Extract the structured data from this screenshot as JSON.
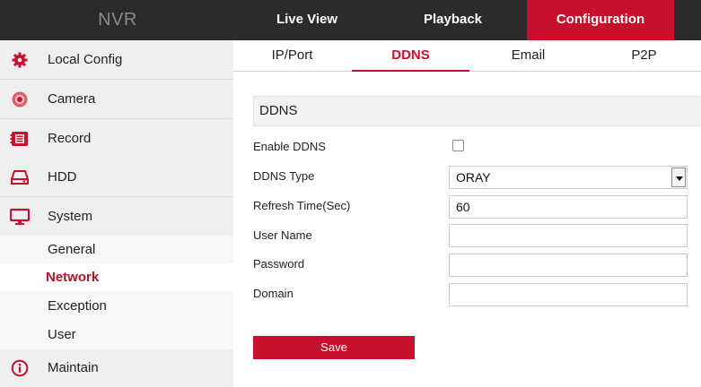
{
  "app": {
    "logo": "NVR"
  },
  "topnav": [
    {
      "label": "Live View"
    },
    {
      "label": "Playback"
    },
    {
      "label": "Configuration"
    }
  ],
  "sidebar": {
    "items": [
      {
        "label": "Local Config",
        "icon": "gear-icon"
      },
      {
        "label": "Camera",
        "icon": "camera-icon"
      },
      {
        "label": "Record",
        "icon": "record-icon"
      },
      {
        "label": "HDD",
        "icon": "hdd-icon"
      },
      {
        "label": "System",
        "icon": "monitor-icon"
      },
      {
        "label": "Maintain",
        "icon": "info-icon"
      }
    ],
    "subitems": [
      {
        "label": "General"
      },
      {
        "label": "Network"
      },
      {
        "label": "Exception"
      },
      {
        "label": "User"
      }
    ]
  },
  "tabs": [
    {
      "label": "IP/Port"
    },
    {
      "label": "DDNS"
    },
    {
      "label": "Email"
    },
    {
      "label": "P2P"
    }
  ],
  "section": {
    "title": "DDNS"
  },
  "form": {
    "enable_label": "Enable DDNS",
    "enable_checked": false,
    "type_label": "DDNS Type",
    "type_value": "ORAY",
    "refresh_label": "Refresh Time(Sec)",
    "refresh_value": "60",
    "username_label": "User Name",
    "username_value": "",
    "password_label": "Password",
    "password_value": "",
    "domain_label": "Domain",
    "domain_value": ""
  },
  "save_label": "Save",
  "colors": {
    "accent": "#c8102e",
    "topbar": "#2b2b2b",
    "sidebar": "#efefef"
  }
}
